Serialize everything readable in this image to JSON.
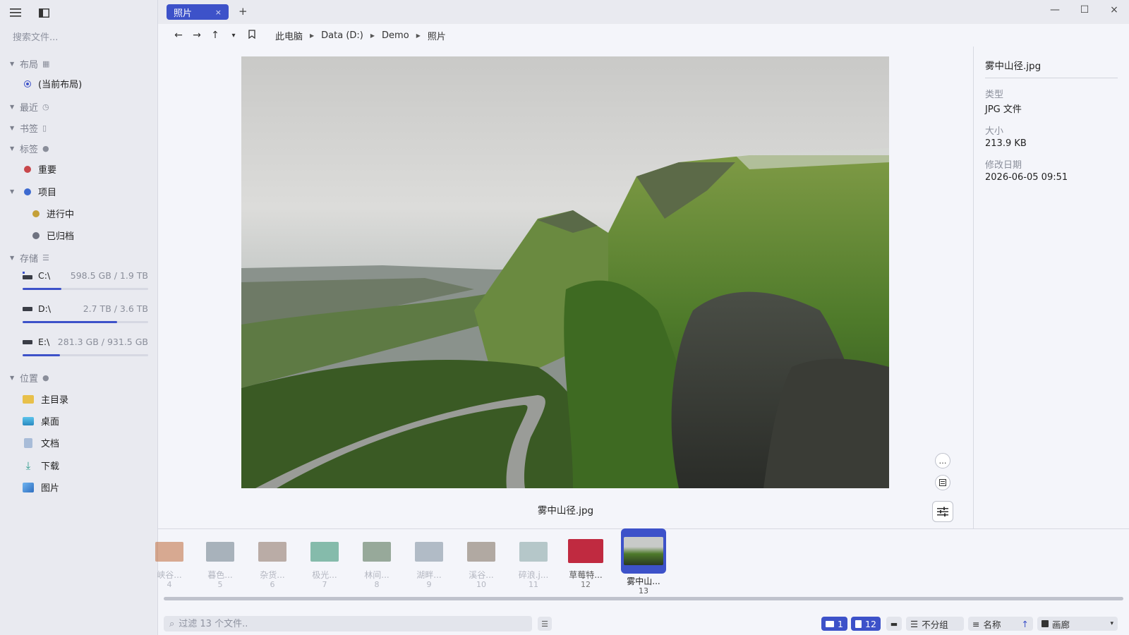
{
  "window": {
    "tab_title": "照片",
    "tab_close": "×",
    "tab_add": "+",
    "minimize": "—",
    "maximize": "☐",
    "close": "×"
  },
  "sidebar": {
    "search_placeholder": "搜索文件...",
    "layout": {
      "label": "布局",
      "current": "(当前布局)"
    },
    "recent": {
      "label": "最近"
    },
    "bookmarks": {
      "label": "书签"
    },
    "tags": {
      "label": "标签",
      "items": [
        {
          "label": "重要",
          "color": "#c8474b"
        },
        {
          "label": "项目",
          "color": "#3d6ad0"
        },
        {
          "label": "进行中",
          "color": "#c4a038"
        },
        {
          "label": "已归档",
          "color": "#6e7280"
        }
      ]
    },
    "storage": {
      "label": "存储",
      "drives": [
        {
          "name": "C:\\",
          "usage": "598.5 GB / 1.9 TB",
          "fraction": 0.31
        },
        {
          "name": "D:\\",
          "usage": "2.7 TB / 3.6 TB",
          "fraction": 0.75
        },
        {
          "name": "E:\\",
          "usage": "281.3 GB / 931.5 GB",
          "fraction": 0.3
        }
      ]
    },
    "places": {
      "label": "位置",
      "items": [
        {
          "label": "主目录",
          "icon": "folder-icon",
          "color": "#e8c04a"
        },
        {
          "label": "桌面",
          "icon": "desktop-icon",
          "color": "#3aa8d8"
        },
        {
          "label": "文档",
          "icon": "document-icon",
          "color": "#8aa4c8"
        },
        {
          "label": "下载",
          "icon": "download-icon",
          "color": "#2a9a8a"
        },
        {
          "label": "图片",
          "icon": "pictures-icon",
          "color": "#2f7fd0"
        }
      ]
    }
  },
  "toolbar": {
    "back": "←",
    "forward": "→",
    "up": "↑",
    "history": "▾",
    "breadcrumb": [
      "此电脑",
      "Data (D:)",
      "Demo",
      "照片"
    ]
  },
  "preview": {
    "caption": "雾中山径.jpg",
    "more_label": "…"
  },
  "info": {
    "filename": "雾中山径.jpg",
    "type_label": "类型",
    "type_value": "JPG 文件",
    "size_label": "大小",
    "size_value": "213.9 KB",
    "modified_label": "修改日期",
    "modified_value": "2026-06-05 09:51"
  },
  "filmstrip": [
    {
      "name": "峡谷...",
      "num": "4",
      "color": "#c06a3a"
    },
    {
      "name": "暮色...",
      "num": "5",
      "color": "#6a7a86"
    },
    {
      "name": "杂货...",
      "num": "6",
      "color": "#8a7060"
    },
    {
      "name": "极光...",
      "num": "7",
      "color": "#2a8a6a"
    },
    {
      "name": "林间...",
      "num": "8",
      "color": "#4a6a4a"
    },
    {
      "name": "湖畔...",
      "num": "9",
      "color": "#7a8a9a"
    },
    {
      "name": "溪谷...",
      "num": "10",
      "color": "#7a6a5a"
    },
    {
      "name": "碎浪.j...",
      "num": "11",
      "color": "#9ab4b4"
    },
    {
      "name": "草莓特...",
      "num": "12",
      "color": "#c02a40"
    },
    {
      "name": "雾中山...",
      "num": "13",
      "color": "#4a6a3a"
    }
  ],
  "status": {
    "filter_placeholder": "过滤 13 个文件..",
    "folders": "1",
    "files": "12",
    "group": "不分组",
    "sort": "名称",
    "sort_dir": "↑",
    "view": "画廊",
    "view_arrow": "▾",
    "accent": "#3d52c9"
  }
}
